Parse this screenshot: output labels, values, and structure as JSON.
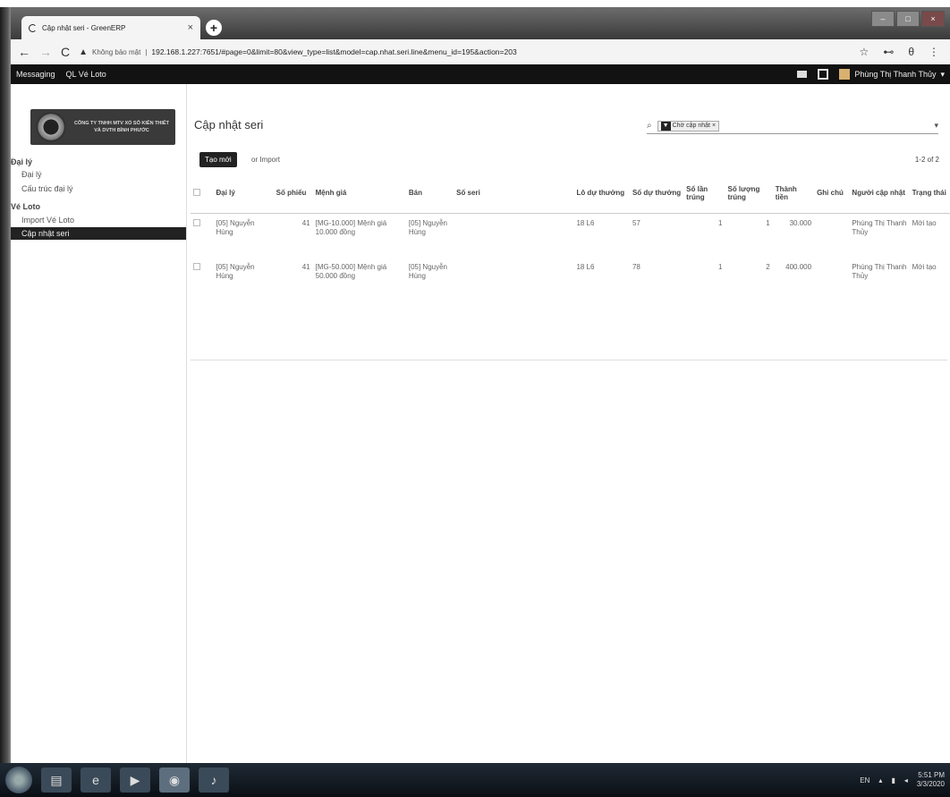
{
  "browser": {
    "tab_title": "Cập nhật seri - GreenERP",
    "tab_close": "×",
    "new_tab": "+",
    "window_controls": [
      "–",
      "□",
      "×"
    ],
    "back": "←",
    "forward": "→",
    "reload": "C",
    "security_label": "Không bảo mật",
    "url": "192.168.1.227:7651/#page=0&limit=80&view_type=list&model=cap.nhat.seri.line&menu_id=195&action=203",
    "star": "☆",
    "key": "⊷",
    "profile": "θ",
    "more": "⋮"
  },
  "topbar": {
    "menu": [
      "Messaging",
      "QL Vé Loto"
    ],
    "user_name": "Phùng Thị Thanh Thủy"
  },
  "logo": {
    "text": "CÔNG TY TNHH MTV XỔ SỐ KIẾN THIẾT VÀ DVTH BÌNH PHƯỚC"
  },
  "sidebar": {
    "sections": [
      {
        "title": "Đại lý",
        "items": [
          "Đại lý",
          "Cấu trúc đại lý"
        ]
      },
      {
        "title": "Vé Loto",
        "items": [
          "Import Vé Loto",
          "Cập nhật seri"
        ]
      }
    ]
  },
  "main": {
    "title": "Cập nhật seri",
    "search_facet": "Chờ cập nhật",
    "create_button": "Tạo mới",
    "import_button": "or Import",
    "pager": "1-2 of 2",
    "columns": [
      "Đại lý",
      "Số phiếu",
      "Mệnh giá",
      "Bán",
      "Số seri",
      "Lô dự thưởng",
      "Số dự thưởng",
      "Số lần trúng",
      "Số lượng trúng",
      "Thành tiền",
      "Ghi chú",
      "Người cập nhật",
      "Trạng thái"
    ],
    "rows": [
      {
        "dai_ly": "[05] Nguyễn Hùng",
        "so_phieu": "41",
        "menh_gia": "[MG-10.000] Mệnh giá 10.000 đồng",
        "ban": "[05] Nguyễn Hùng",
        "so_seri": "",
        "lo_du_thuong": "18 L6",
        "so_du_thuong": "57",
        "so_lan_trung": "1",
        "so_luong_trung": "1",
        "thanh_tien": "30.000",
        "ghi_chu": "",
        "nguoi_cap_nhat": "Phùng Thị Thanh Thủy",
        "trang_thai": "Mới tạo"
      },
      {
        "dai_ly": "[05] Nguyễn Hùng",
        "so_phieu": "41",
        "menh_gia": "[MG-50.000] Mệnh giá 50.000 đồng",
        "ban": "[05] Nguyễn Hùng",
        "so_seri": "",
        "lo_du_thuong": "18 L6",
        "so_du_thuong": "78",
        "so_lan_trung": "1",
        "so_luong_trung": "2",
        "thanh_tien": "400.000",
        "ghi_chu": "",
        "nguoi_cap_nhat": "Phùng Thị Thanh Thủy",
        "trang_thai": "Mới tạo"
      }
    ]
  },
  "taskbar": {
    "lang": "EN",
    "time": "5:51 PM",
    "date": "3/3/2020"
  }
}
